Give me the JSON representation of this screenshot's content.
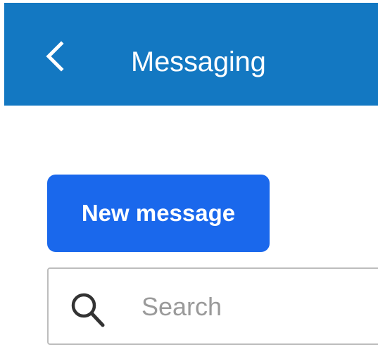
{
  "header": {
    "title": "Messaging",
    "back_icon": "chevron-left-icon",
    "background_color": "#1378c2"
  },
  "actions": {
    "new_message_label": "New message",
    "button_color": "#1a68ec"
  },
  "search": {
    "placeholder": "Search",
    "value": "",
    "icon": "search-icon"
  }
}
